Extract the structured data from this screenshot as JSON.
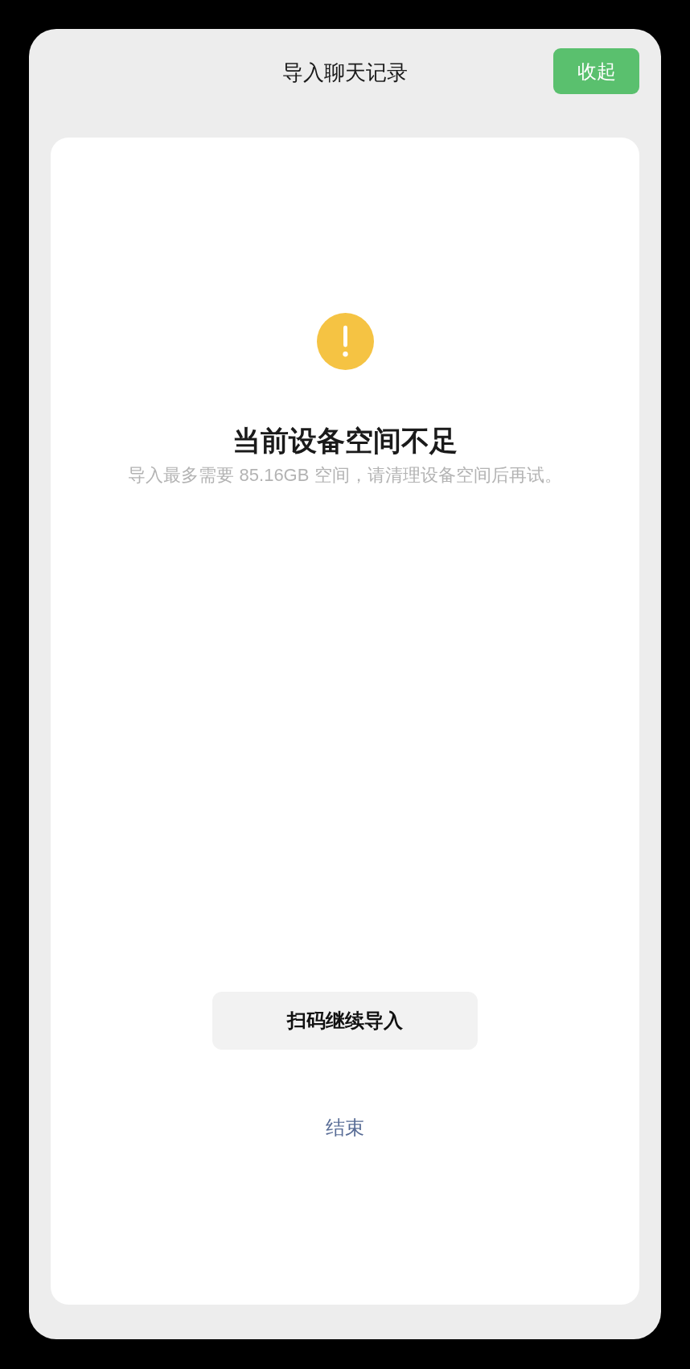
{
  "header": {
    "title": "导入聊天记录",
    "collapse_button": "收起"
  },
  "notice": {
    "kind": "warning",
    "title": "当前设备空间不足",
    "message": "导入最多需要 85.16GB 空间，请清理设备空间后再试。"
  },
  "actions": [
    {
      "kind": "secondary",
      "label": "扫码继续导入"
    },
    {
      "kind": "link",
      "label": "结束"
    }
  ]
}
